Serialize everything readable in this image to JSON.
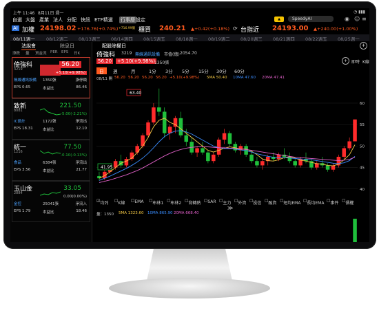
{
  "status": {
    "time": "上午 11:46",
    "date": "8月11日 週一"
  },
  "menu": [
    "自選",
    "大盤",
    "產業",
    "法人",
    "分配",
    "快訊",
    "ETF精選",
    "行事曆",
    "設定"
  ],
  "menu_active_index": 7,
  "speedy_label": "SpeedyAI",
  "ticker": {
    "logo": "AI",
    "name1": "加權",
    "value1": "24198.02",
    "change1": "+176.76(+0.74%)",
    "badge": "+716.99億",
    "name2": "櫃買",
    "value2": "240.21",
    "change2": "▲+0.42(+0.18%)",
    "name3": "台指近",
    "value3": "24193.00",
    "change3": "▲+240.00(+1.00%)"
  },
  "dates": [
    "08/11週一",
    "08/12週二",
    "08/13週三",
    "08/14週四",
    "08/15週五",
    "08/18週一",
    "08/19週二",
    "08/20週三",
    "08/21週四",
    "08/22週五",
    "08/25週一"
  ],
  "left": {
    "tabs": [
      "法說會",
      "除息日"
    ],
    "columns": [
      "漲跌",
      "量",
      "資金流",
      "PER",
      "EPS",
      "日K"
    ],
    "cards": [
      {
        "name": "倚強科",
        "code": "3219",
        "price": "56.20",
        "change": "+5.10(+9.98%)",
        "label1": "無線通訊設備",
        "value1": "1350張",
        "right1": "漲停鎖",
        "label2": "EPS 0.65",
        "value2": "本益比",
        "right2": "86.46",
        "up": true
      },
      {
        "name": "致新",
        "code": "8081",
        "price": "221.50",
        "change": "-5.00(-2.21%)",
        "label1": "IC設計",
        "value1": "1172張",
        "right1": "淨流出",
        "label2": "EPS 18.31",
        "value2": "本益比",
        "right2": "12.10",
        "up": false
      },
      {
        "name": "統一",
        "code": "1216",
        "price": "77.50",
        "change": "-0.10(-0.13%)",
        "label1": "食品",
        "value1": "6384張",
        "right1": "淨流出",
        "label2": "EPS 3.56",
        "value2": "本益比",
        "right2": "21.77",
        "up": false
      },
      {
        "name": "玉山金",
        "code": "2884",
        "price": "33.05",
        "change": "0.00(0.00%)",
        "label1": "金控",
        "value1": "25041張",
        "right1": "淨流入",
        "label2": "EPS 1.79",
        "value2": "本益比",
        "right2": "18.46",
        "up": true
      }
    ]
  },
  "right": {
    "tabs": [
      "配股除權日"
    ],
    "name": "倚強科",
    "code": "3219",
    "industry": "無線通訊設備",
    "mktcap_label": "市值(億)",
    "mktcap": "2054.70",
    "price": "56.20",
    "change": "+5.10(+9.98%)",
    "volume": "1350張",
    "buttons": [
      "即時",
      "K線"
    ],
    "periods": [
      "日",
      "週",
      "月",
      "1分",
      "3分",
      "5分",
      "15分",
      "30分",
      "60分"
    ],
    "ma_legend": {
      "date": "08/11 開",
      "o": "56.20",
      "h": "56.20",
      "l": "56.20",
      "c": "56.20",
      "chg": "+5.10(+9.98%)",
      "ma5": "5MA 50.40",
      "ma10": "10MA 47.60",
      "ma20": "20MA 47.41"
    },
    "indicators": [
      "均列",
      "K線",
      "EMA",
      "布林1",
      "布林2",
      "背轉熱",
      "SAR",
      "主力",
      "外資",
      "投信",
      "融資",
      "短均EMA",
      "長均EMA",
      "事件",
      "債權"
    ],
    "vol_legend": {
      "vol": "量：1350",
      "ma5": "5MA 1323.60",
      "ma10": "10MA 865.90",
      "ma20": "20MA 668.40"
    }
  },
  "chart_data": {
    "type": "candlestick",
    "y_ticks": [
      "60",
      "55",
      "50",
      "45",
      "40"
    ],
    "high_label": "63.40",
    "low_label": "41.95",
    "ylim": [
      39,
      64
    ],
    "candles": [
      [
        43,
        44,
        41.95,
        42.5
      ],
      [
        42.5,
        44.5,
        42,
        44
      ],
      [
        44,
        45.5,
        43.5,
        45
      ],
      [
        45,
        47,
        44.5,
        46.5
      ],
      [
        46.5,
        48,
        45,
        45.5
      ],
      [
        45.5,
        47.5,
        45,
        47
      ],
      [
        47,
        49,
        46.5,
        48.5
      ],
      [
        48.5,
        50.5,
        48,
        50
      ],
      [
        50,
        53,
        49.5,
        52.5
      ],
      [
        52.5,
        56,
        52,
        55.5
      ],
      [
        55.5,
        60,
        55,
        59
      ],
      [
        59,
        63.4,
        57,
        58
      ],
      [
        58,
        59,
        52,
        53
      ],
      [
        53,
        55,
        51.5,
        54.5
      ],
      [
        54.5,
        57,
        53,
        56.5
      ],
      [
        56.5,
        58,
        52,
        52.5
      ],
      [
        52.5,
        54,
        50,
        51
      ],
      [
        51,
        52,
        48,
        48.5
      ],
      [
        48.5,
        50,
        47.5,
        49.5
      ],
      [
        49.5,
        51,
        48,
        48.5
      ],
      [
        48.5,
        49,
        46,
        46.5
      ],
      [
        46.5,
        48.5,
        46,
        48
      ],
      [
        48,
        52,
        47.5,
        51.5
      ],
      [
        51.5,
        54,
        50.5,
        53
      ],
      [
        53,
        53.5,
        50,
        50.5
      ],
      [
        50.5,
        51,
        48.5,
        49
      ],
      [
        49,
        50.5,
        48,
        50
      ],
      [
        50,
        50.5,
        47.5,
        48
      ],
      [
        48,
        49,
        46,
        46.5
      ],
      [
        46.5,
        47.5,
        45,
        45.5
      ],
      [
        45.5,
        47,
        44.5,
        46.5
      ],
      [
        46.5,
        48,
        45.5,
        47.5
      ],
      [
        47.5,
        48.5,
        46.5,
        47
      ],
      [
        47,
        48.5,
        46.5,
        48
      ],
      [
        48,
        49.5,
        47,
        47.5
      ],
      [
        47.5,
        48.5,
        46,
        46.5
      ],
      [
        46.5,
        47,
        45,
        45.5
      ],
      [
        45.5,
        47.5,
        45,
        47
      ],
      [
        47,
        48.5,
        46,
        46.5
      ],
      [
        46.5,
        47,
        44.5,
        45
      ],
      [
        45,
        46.5,
        44.5,
        46
      ],
      [
        46,
        47.5,
        45,
        45.5
      ],
      [
        45.5,
        46,
        44,
        44.5
      ],
      [
        44.5,
        46,
        44,
        45.5
      ],
      [
        45.5,
        48,
        45,
        47.5
      ],
      [
        47.5,
        50,
        47,
        49.5
      ],
      [
        49.5,
        52,
        49,
        51.1
      ],
      [
        51.1,
        56.2,
        51.1,
        56.2
      ]
    ],
    "ma5": [
      42.5,
      43.1,
      44,
      45,
      46,
      46.5,
      47.2,
      48.5,
      50,
      52,
      54.5,
      56,
      56.5,
      55.5,
      55,
      54,
      53,
      52,
      51,
      50,
      49,
      48.6,
      49,
      49.5,
      49.8,
      49.6,
      49.3,
      49.3,
      48.8,
      48,
      47,
      46.6,
      46.5,
      46.8,
      47.3,
      47.5,
      47.2,
      46.7,
      46.5,
      46.2,
      45.9,
      45.8,
      45.5,
      45.4,
      45.8,
      46.8,
      48,
      50.3
    ],
    "ma10": [
      42,
      42.5,
      43,
      43.6,
      44.2,
      44.8,
      45.5,
      46.3,
      47.2,
      48.3,
      49.6,
      51,
      52.2,
      53,
      53.5,
      53.6,
      53.3,
      52.8,
      52.1,
      51.4,
      50.7,
      50,
      49.6,
      49.4,
      49.4,
      49.3,
      49.1,
      48.9,
      48.6,
      48.2,
      47.9,
      47.6,
      47.4,
      47.3,
      47.3,
      47.2,
      47.1,
      47,
      46.9,
      46.8,
      46.6,
      46.4,
      46.2,
      46,
      45.9,
      46.1,
      46.6,
      47.6
    ],
    "ma20": [
      41.5,
      41.8,
      42.1,
      42.5,
      42.9,
      43.3,
      43.8,
      44.3,
      44.9,
      45.6,
      46.3,
      47,
      47.7,
      48.3,
      48.8,
      49.2,
      49.5,
      49.7,
      49.8,
      49.8,
      49.8,
      49.7,
      49.6,
      49.6,
      49.5,
      49.4,
      49.3,
      49.2,
      49,
      48.8,
      48.6,
      48.4,
      48.2,
      48,
      47.8,
      47.6,
      47.4,
      47.3,
      47.2,
      47.1,
      47,
      46.9,
      46.8,
      46.7,
      46.6,
      46.7,
      46.9,
      47.4
    ],
    "volumes": [
      0,
      0,
      0,
      0,
      0,
      0,
      0,
      0,
      0,
      0,
      0,
      0,
      0,
      0,
      0,
      0,
      0,
      0,
      0,
      0,
      0,
      0,
      0,
      0,
      0,
      0,
      0,
      0,
      0,
      0,
      0,
      0,
      0,
      0,
      0,
      0,
      0,
      0,
      0,
      0,
      0,
      0,
      0,
      0,
      0,
      0,
      0,
      1350
    ]
  },
  "colors": {
    "up": "#ff2b2b",
    "down": "#1fbf3b",
    "ma5": "#f2c744",
    "ma10": "#3a8dff",
    "ma20": "#e060c8",
    "accent": "#ff5a1f"
  }
}
